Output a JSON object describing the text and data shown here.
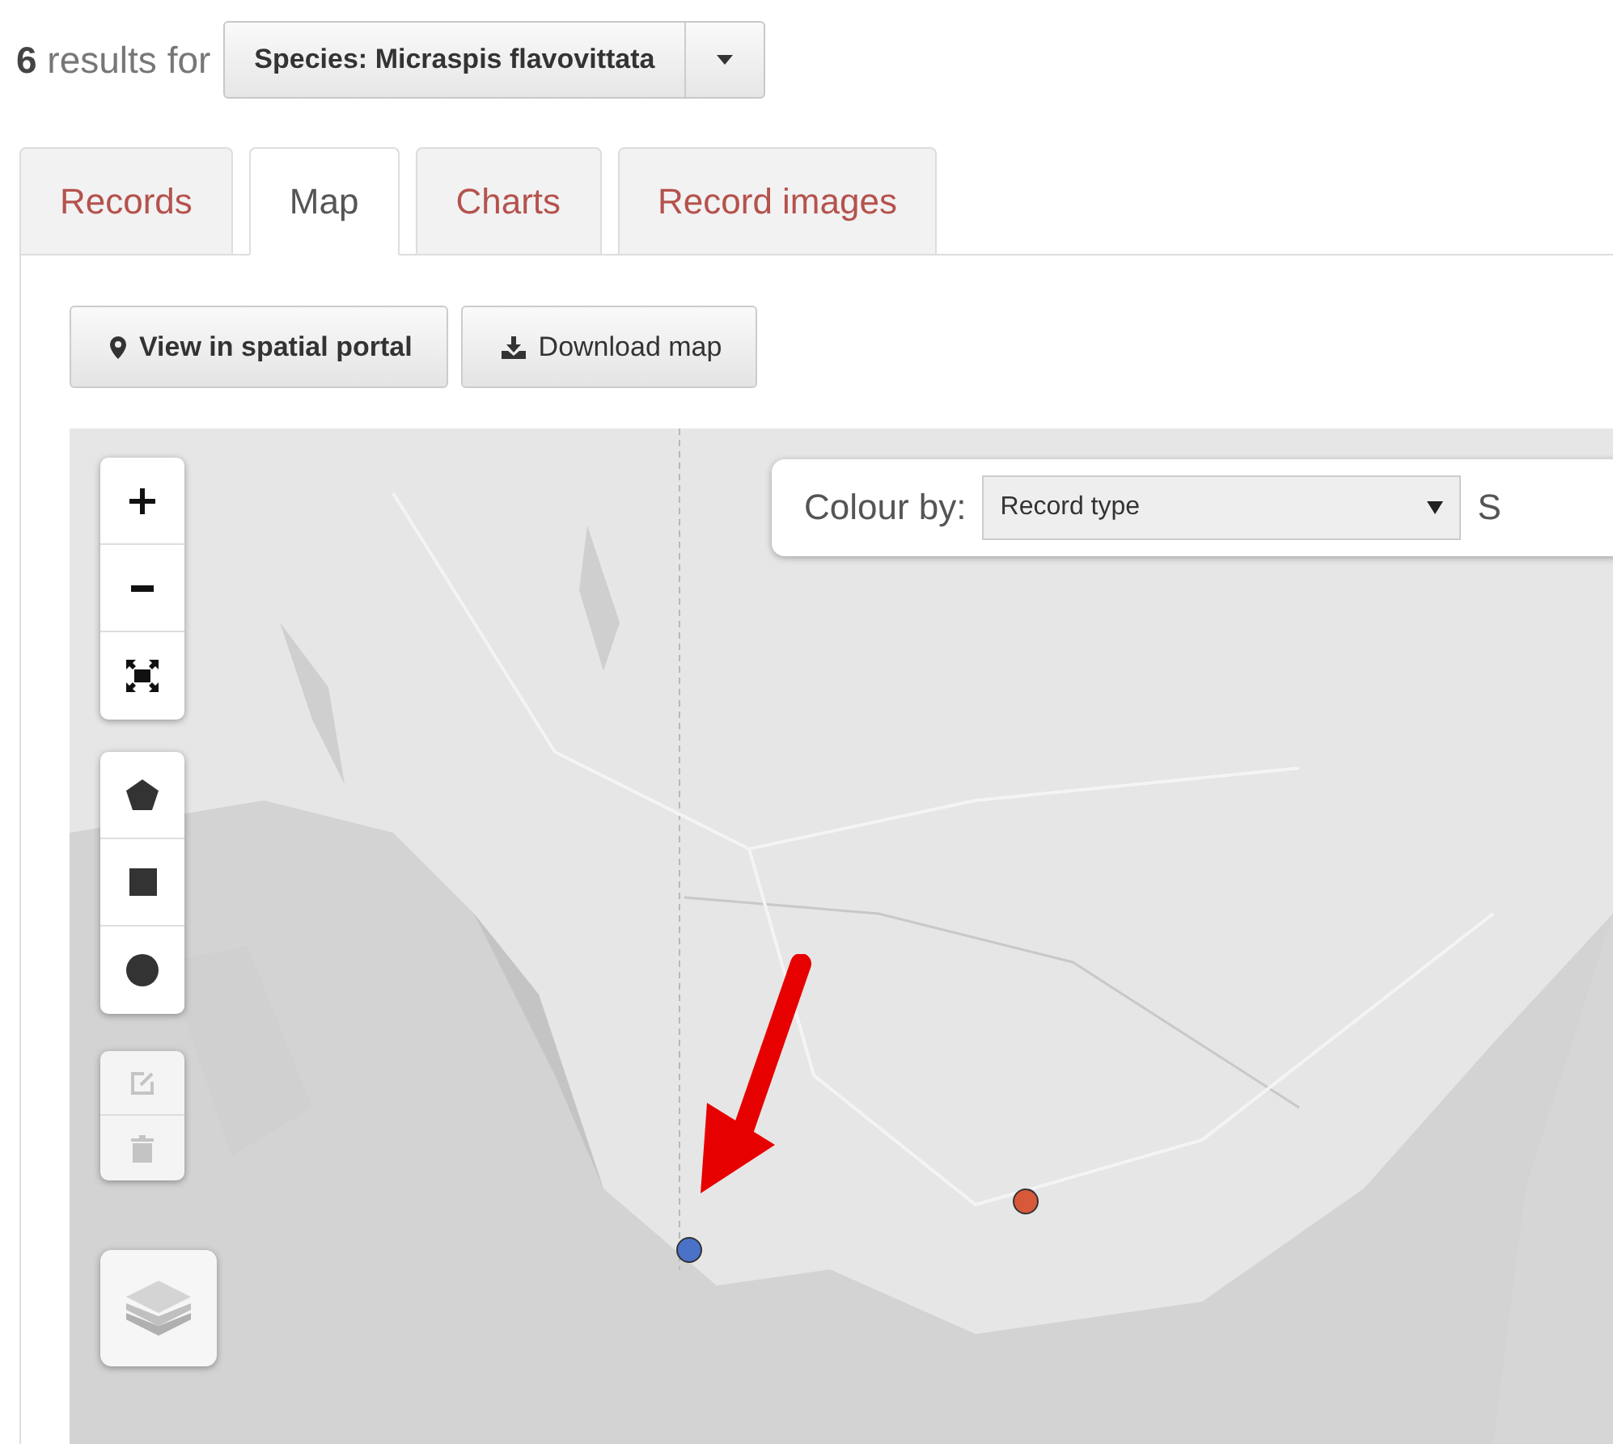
{
  "results": {
    "count": "6",
    "label": "results for"
  },
  "filter_button": {
    "label": "Species: Micraspis flavovittata"
  },
  "tabs": [
    {
      "label": "Records",
      "selected": false
    },
    {
      "label": "Map",
      "selected": true
    },
    {
      "label": "Charts",
      "selected": false
    },
    {
      "label": "Record images",
      "selected": false
    }
  ],
  "actions": [
    {
      "kind": "portal",
      "label": "View in spatial portal"
    },
    {
      "kind": "download",
      "label": "Download map"
    }
  ],
  "map": {
    "kind": "picture",
    "colour_by": {
      "label": "Colour by:",
      "value": "Record type",
      "next_label": "S"
    },
    "draw_tools": [
      {
        "kind": "edit",
        "disabled": true
      },
      {
        "kind": "delete",
        "disabled": true
      }
    ],
    "markers": [
      {
        "color": "#4a72c8"
      },
      {
        "color": "#d8583a"
      }
    ]
  }
}
